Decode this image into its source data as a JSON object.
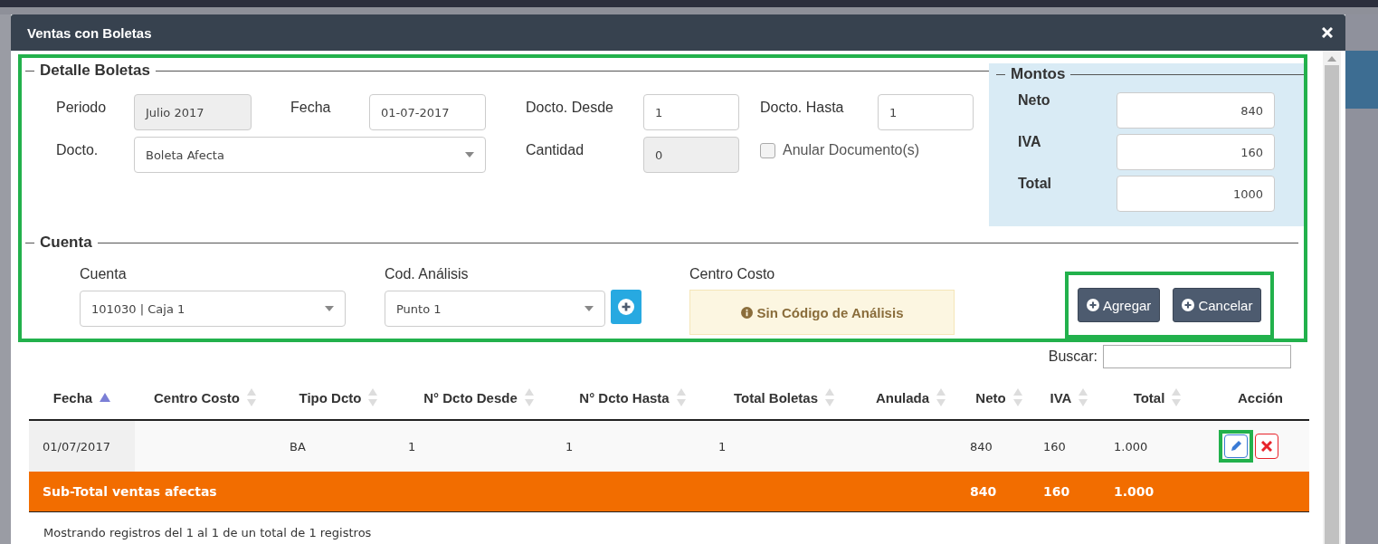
{
  "dialog": {
    "title": "Ventas con Boletas"
  },
  "form": {
    "highlighted": true,
    "detalle": {
      "legend": "Detalle Boletas",
      "periodo": {
        "label": "Periodo",
        "value": "Julio 2017",
        "readonly": true
      },
      "fecha": {
        "label": "Fecha",
        "value": "01-07-2017",
        "readonly": false
      },
      "desde": {
        "label": "Docto. Desde",
        "value": "1",
        "readonly": false
      },
      "hasta": {
        "label": "Docto. Hasta",
        "value": "1",
        "readonly": false
      },
      "docto": {
        "label": "Docto.",
        "value": "Boleta Afecta"
      },
      "cantidad": {
        "label": "Cantidad",
        "value": "0",
        "readonly": true
      },
      "anular": {
        "label": "Anular Documento(s)",
        "checked": false
      }
    },
    "montos": {
      "legend": "Montos",
      "fields": [
        {
          "label": "Neto",
          "value": "840"
        },
        {
          "label": "IVA",
          "value": "160"
        },
        {
          "label": "Total",
          "value": "1000"
        }
      ]
    },
    "cuenta": {
      "legend": "Cuenta",
      "cuenta": {
        "label": "Cuenta",
        "value": "101030 | Caja 1"
      },
      "analisis": {
        "label": "Cod. Análisis",
        "value": "Punto 1"
      },
      "centro": {
        "label": "Centro Costo",
        "notice": "Sin Código de Análisis"
      }
    },
    "actions": {
      "highlighted": true,
      "buttons": [
        "Agregar",
        "Cancelar"
      ]
    }
  },
  "table": {
    "search_label": "Buscar:",
    "columns": [
      {
        "label": "Fecha",
        "sorted": true
      },
      {
        "label": "Centro Costo",
        "sorted": false
      },
      {
        "label": "Tipo Dcto",
        "sorted": false
      },
      {
        "label": "N° Dcto Desde",
        "sorted": false
      },
      {
        "label": "N° Dcto Hasta",
        "sorted": false
      },
      {
        "label": "Total Boletas",
        "sorted": false
      },
      {
        "label": "Anulada",
        "sorted": false
      },
      {
        "label": "Neto",
        "sorted": false
      },
      {
        "label": "IVA",
        "sorted": false
      },
      {
        "label": "Total",
        "sorted": false
      },
      {
        "label": "Acción"
      }
    ],
    "rows": [
      {
        "cells": [
          "01/07/2017",
          null,
          "BA",
          "1",
          "1",
          "1",
          null,
          "840",
          "160",
          "1.000"
        ],
        "edit_highlighted": true
      }
    ],
    "subtotal": {
      "label": "Sub-Total ventas afectas",
      "neto": "840",
      "iva": "160",
      "total": "1.000"
    },
    "info": "Mostrando registros del 1 al 1 de un total de 1 registros"
  }
}
